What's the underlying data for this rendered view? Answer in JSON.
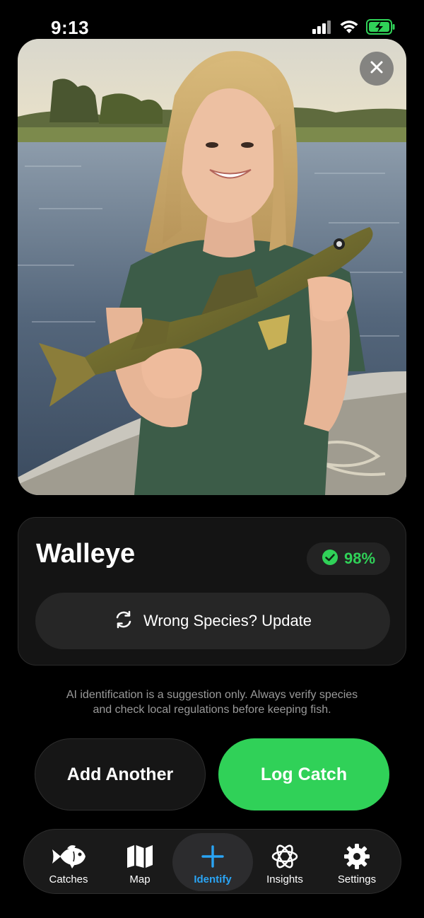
{
  "status_bar": {
    "time": "9:13"
  },
  "result": {
    "species": "Walleye",
    "confidence": "98%",
    "update_label": "Wrong Species? Update"
  },
  "disclaimer": {
    "line1": "AI identification is a suggestion only. Always verify species",
    "line2": "and check local regulations before keeping fish."
  },
  "actions": {
    "add_another": "Add Another",
    "log_catch": "Log Catch"
  },
  "tabs": [
    {
      "label": "Catches",
      "icon": "fish-icon"
    },
    {
      "label": "Map",
      "icon": "map-icon"
    },
    {
      "label": "Identify",
      "icon": "plus-icon",
      "active": true
    },
    {
      "label": "Insights",
      "icon": "atom-icon"
    },
    {
      "label": "Settings",
      "icon": "gear-icon"
    }
  ],
  "colors": {
    "accent_green": "#30d158",
    "active_tab_blue": "#2aa4f4",
    "background": "#000000"
  }
}
